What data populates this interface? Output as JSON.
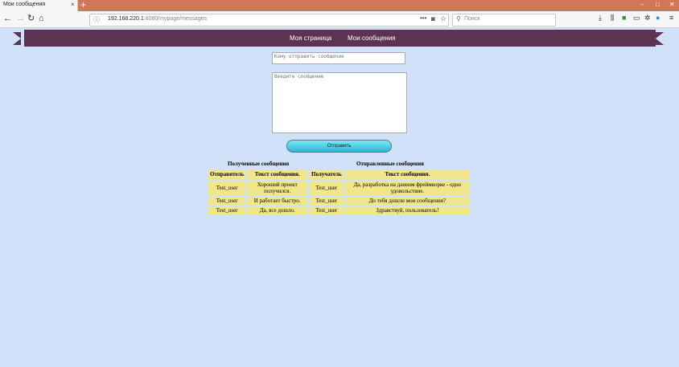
{
  "browser": {
    "tab_title": "Мои сообщения",
    "new_tab_glyph": "+",
    "url_host": "192.168.220.1",
    "url_path": ":8080/mypage/messages",
    "search_placeholder": "Поиск",
    "window_controls": [
      "–",
      "□",
      "✕"
    ]
  },
  "site_nav": {
    "links": [
      "Моя страница",
      "Мои сообщения"
    ]
  },
  "form": {
    "recipient_placeholder": "Кому отправить сообщение",
    "message_placeholder": "Введите сообщение",
    "send_label": "Отправить"
  },
  "received": {
    "caption": "Полученные сообщения",
    "headers": [
      "Отправитель",
      "Текст сообщения."
    ],
    "rows": [
      [
        "Test_user",
        "Хороший проект получился."
      ],
      [
        "Test_user",
        "И работает быстро."
      ],
      [
        "Test_user",
        "Да, все дошло."
      ]
    ]
  },
  "sent": {
    "caption": "Отправленные сообщения",
    "headers": [
      "Получатель",
      "Текст сообщения."
    ],
    "rows": [
      [
        "Test_user",
        "Да, разработка на данном фреймворке - одно удовольствие."
      ],
      [
        "Test_user",
        "До тебя дошли мои сообщения?"
      ],
      [
        "Test_user",
        "Здравствуй, пользователь!"
      ]
    ]
  }
}
